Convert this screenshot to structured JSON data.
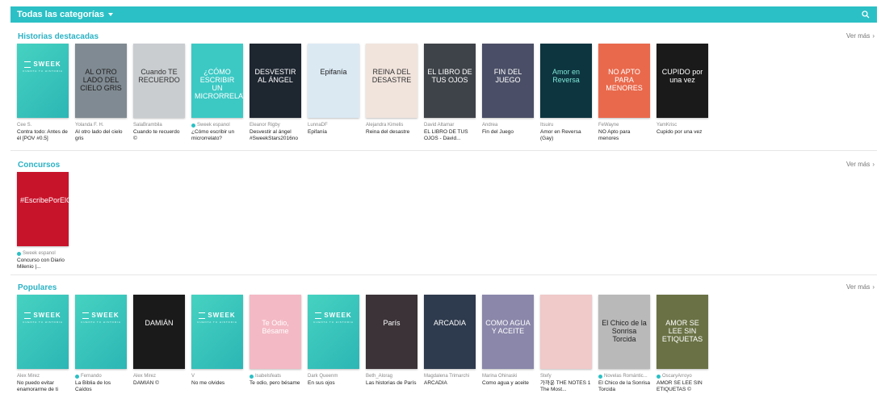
{
  "topbar": {
    "category_label": "Todas las categorías"
  },
  "ver_mas": "Ver más",
  "sweek_logo": "SWEEK",
  "sweek_sub": "CUENTA TU HISTORIA",
  "sections": [
    {
      "title": "Historias destacadas",
      "books": [
        {
          "author": "Cee S.",
          "title": "Contra todo: Antes de él [POV #0.5]",
          "cover": {
            "type": "sweek"
          }
        },
        {
          "author": "Yolanda F. H.",
          "title": "Al otro lado del cielo gris",
          "cover": {
            "text": "AL OTRO LADO DEL CIELO GRIS",
            "color": "#7f8a92",
            "fg": "#222"
          }
        },
        {
          "author": "SalaBrambila",
          "title": "Cuando te recuerdo ©",
          "cover": {
            "text": "Cuando TE RECUERDO",
            "color": "#c9cdd0",
            "fg": "#333"
          }
        },
        {
          "author": "Sweek espanol",
          "verified": true,
          "title": "¿Cómo escribir un microrrelato?",
          "cover": {
            "text": "¿CÓMO ESCRIBIR UN MICRORRELATO?",
            "color": "#3cc9c4",
            "fg": "#ffffff"
          }
        },
        {
          "author": "Eleanor Rigby",
          "title": "Desvestir al ángel #SweekStars2016no",
          "cover": {
            "text": "DESVESTIR AL ÁNGEL",
            "color": "#1e2630",
            "fg": "#ffffff"
          }
        },
        {
          "author": "LunnaDF",
          "title": "Epifanía",
          "cover": {
            "text": "Epifanía",
            "color": "#dbe9f3",
            "fg": "#222"
          }
        },
        {
          "author": "Alejandra Kimelis",
          "title": "Reina del desastre",
          "cover": {
            "text": "REINA DEL DESASTRE",
            "color": "#f1e4dd",
            "fg": "#333"
          }
        },
        {
          "author": "David Altamar",
          "title": "EL LIBRO DE TUS OJOS - David...",
          "cover": {
            "text": "EL LIBRO DE TUS OJOS",
            "color": "#3e4349",
            "fg": "#ffffff"
          }
        },
        {
          "author": "Andrea",
          "title": "Fin del Juego",
          "cover": {
            "text": "FIN DEL JUEGO",
            "color": "#4a4e66",
            "fg": "#ffffff"
          }
        },
        {
          "author": "Itsuiru",
          "title": "Amor en Reversa (Gay)",
          "cover": {
            "text": "Amor en Reversa",
            "color": "#0d3540",
            "fg": "#7ee8d8"
          }
        },
        {
          "author": "FeWayne",
          "title": "NO Apto para menores",
          "cover": {
            "text": "NO APTO PARA MENORES",
            "color": "#e9694c",
            "fg": "#ffffff"
          }
        },
        {
          "author": "YamKrisc",
          "title": "Cupido por una vez",
          "cover": {
            "text": "CUPIDO por una vez",
            "color": "#1a1a1a",
            "fg": "#ffffff"
          }
        }
      ]
    },
    {
      "title": "Concursos",
      "books": [
        {
          "author": "Sweek espanol",
          "verified": true,
          "title": "Concurso con Diario Milenio |...",
          "cover": {
            "text": "#EscribePorElCambio",
            "color": "#c8142b",
            "fg": "#ffffff"
          }
        }
      ]
    },
    {
      "title": "Populares",
      "books": [
        {
          "author": "Alex Mirez",
          "title": "No puedo evitar enamorarme de ti",
          "cover": {
            "type": "sweek"
          }
        },
        {
          "author": "Fernando",
          "verified": true,
          "title": "La Biblia de los Caídos",
          "cover": {
            "type": "sweek"
          }
        },
        {
          "author": "Alex Mirez",
          "title": "DAMIÁN ©",
          "cover": {
            "text": "DAMIÁN",
            "color": "#1a1a1a",
            "fg": "#ffffff"
          }
        },
        {
          "author": "V",
          "title": "No me olvides",
          "cover": {
            "type": "sweek"
          }
        },
        {
          "author": "Isabelsfeats",
          "verified": true,
          "title": "Te odio, pero bésame",
          "cover": {
            "text": "Te Odio, Bésame",
            "color": "#f3b9c4",
            "fg": "#ffffff"
          }
        },
        {
          "author": "Dark Queenm",
          "title": "En sus ojos",
          "cover": {
            "type": "sweek"
          }
        },
        {
          "author": "Beth_Alorag",
          "title": "Las historias de París",
          "cover": {
            "text": "París",
            "color": "#3b3338",
            "fg": "#ffffff"
          }
        },
        {
          "author": "Magdalena Trimarchi",
          "title": "ARCADIA",
          "cover": {
            "text": "ARCADIA",
            "color": "#2e3a4d",
            "fg": "#ffffff"
          }
        },
        {
          "author": "Marina Ohinaski",
          "title": "Como agua y aceite",
          "cover": {
            "text": "COMO AGUA Y ACEITE",
            "color": "#8a87aa",
            "fg": "#ffffff"
          }
        },
        {
          "author": "Stefy",
          "title": "가까운 THE NOTES 1 The Most...",
          "cover": {
            "text": "",
            "color": "#f0c9c9",
            "fg": "#ffffff"
          }
        },
        {
          "author": "Novelas Romántic...",
          "verified": true,
          "title": "El Chico de la Sonrisa Torcida",
          "cover": {
            "text": "El Chico de la Sonrisa Torcida",
            "color": "#b9b9b9",
            "fg": "#222"
          }
        },
        {
          "author": "OscaryArroyo",
          "verified": true,
          "title": "AMOR SE LEE SIN ETIQUETAS ©",
          "cover": {
            "text": "AMOR SE LEE SIN ETIQUETAS",
            "color": "#6a7245",
            "fg": "#ffffff"
          }
        }
      ]
    }
  ]
}
